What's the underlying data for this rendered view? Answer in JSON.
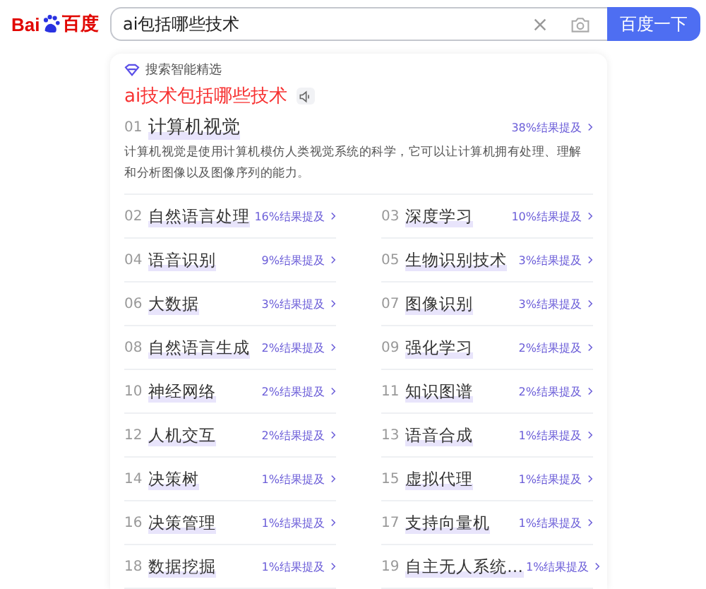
{
  "logo": {
    "text_left": "Bai",
    "text_right": "百度"
  },
  "search": {
    "value": "ai包括哪些技术",
    "button": "百度一下"
  },
  "card": {
    "source": "搜索智能精选",
    "title": "ai技术包括哪些技术",
    "top": {
      "number": "01",
      "name": "计算机视觉",
      "mention": "38%结果提及",
      "description": "计算机视觉是使用计算机模仿人类视觉系统的科学，它可以让计算机拥有处理、理解和分析图像以及图像序列的能力。"
    },
    "items": [
      {
        "number": "02",
        "name": "自然语言处理",
        "mention": "16%结果提及"
      },
      {
        "number": "03",
        "name": "深度学习",
        "mention": "10%结果提及"
      },
      {
        "number": "04",
        "name": "语音识别",
        "mention": "9%结果提及"
      },
      {
        "number": "05",
        "name": "生物识别技术",
        "mention": "3%结果提及"
      },
      {
        "number": "06",
        "name": "大数据",
        "mention": "3%结果提及"
      },
      {
        "number": "07",
        "name": "图像识别",
        "mention": "3%结果提及"
      },
      {
        "number": "08",
        "name": "自然语言生成",
        "mention": "2%结果提及"
      },
      {
        "number": "09",
        "name": "强化学习",
        "mention": "2%结果提及"
      },
      {
        "number": "10",
        "name": "神经网络",
        "mention": "2%结果提及"
      },
      {
        "number": "11",
        "name": "知识图谱",
        "mention": "2%结果提及"
      },
      {
        "number": "12",
        "name": "人机交互",
        "mention": "2%结果提及"
      },
      {
        "number": "13",
        "name": "语音合成",
        "mention": "1%结果提及"
      },
      {
        "number": "14",
        "name": "决策树",
        "mention": "1%结果提及"
      },
      {
        "number": "15",
        "name": "虚拟代理",
        "mention": "1%结果提及"
      },
      {
        "number": "16",
        "name": "决策管理",
        "mention": "1%结果提及"
      },
      {
        "number": "17",
        "name": "支持向量机",
        "mention": "1%结果提及"
      },
      {
        "number": "18",
        "name": "数据挖掘",
        "mention": "1%结果提及"
      },
      {
        "number": "19",
        "name": "自主无人系统…",
        "mention": "1%结果提及"
      }
    ]
  }
}
